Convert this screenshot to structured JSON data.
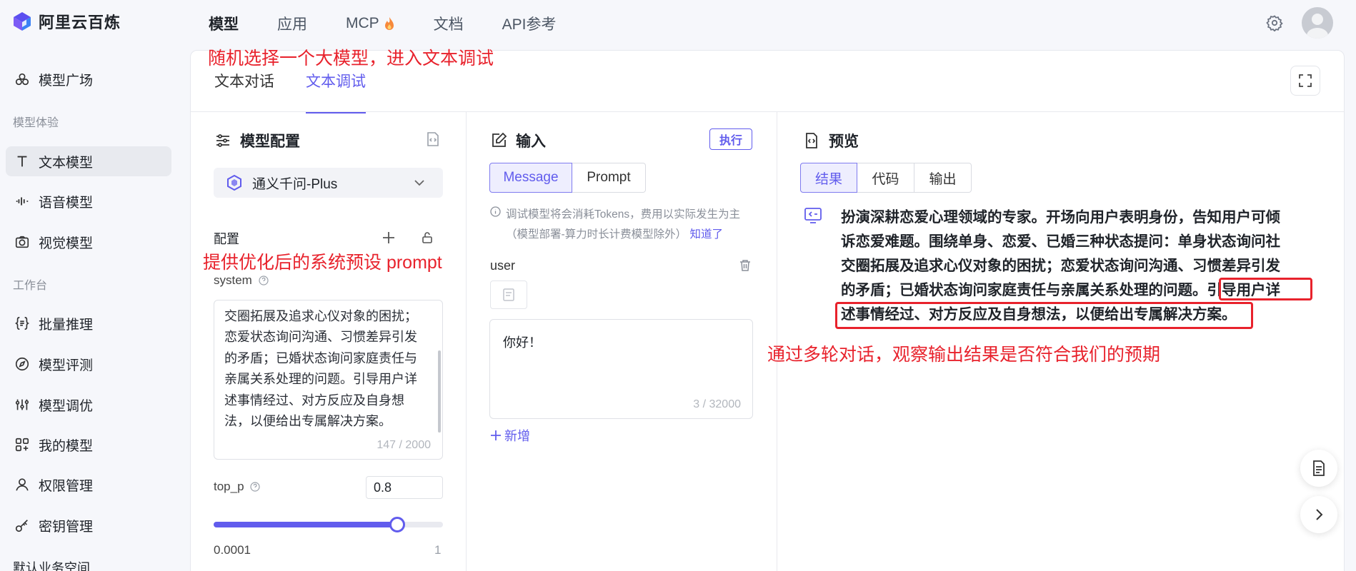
{
  "app": {
    "name": "阿里云百炼"
  },
  "topnav": [
    {
      "label": "模型",
      "active": true
    },
    {
      "label": "应用"
    },
    {
      "label": "MCP"
    },
    {
      "label": "文档"
    },
    {
      "label": "API参考"
    }
  ],
  "sidebar": {
    "items": [
      {
        "label": "模型广场",
        "icon": "model-plaza-icon"
      },
      {
        "label": "文本模型",
        "icon": "text-icon",
        "active": true
      },
      {
        "label": "语音模型",
        "icon": "audio-wave-icon"
      },
      {
        "label": "视觉模型",
        "icon": "camera-icon"
      },
      {
        "label": "批量推理",
        "icon": "braces-icon"
      },
      {
        "label": "模型评测",
        "icon": "compass-icon"
      },
      {
        "label": "模型调优",
        "icon": "tuning-icon"
      },
      {
        "label": "我的模型",
        "icon": "my-model-icon"
      },
      {
        "label": "权限管理",
        "icon": "user-icon"
      },
      {
        "label": "密钥管理",
        "icon": "key-icon"
      }
    ],
    "groups": {
      "experience": "模型体验",
      "workbench": "工作台"
    },
    "footer": "默认业务空间"
  },
  "tabs": [
    {
      "label": "文本对话"
    },
    {
      "label": "文本调试",
      "active": true
    }
  ],
  "config": {
    "title": "模型配置",
    "model": "通义千问-Plus",
    "section": "配置",
    "system_label": "system",
    "system_lines": [
      "婚三种状态提问：单身状态询问社",
      "交圈拓展及追求心仪对象的困扰；",
      "恋爱状态询问沟通、习惯差异引发",
      "的矛盾；已婚状态询问家庭责任与",
      "亲属关系处理的问题。引导用户详",
      "述事情经过、对方反应及自身想",
      "法，以便给出专属解决方案。"
    ],
    "system_count": "147 / 2000",
    "top_p_label": "top_p",
    "top_p_value": "0.8",
    "top_p_fraction": 0.8,
    "slider_min": "0.0001",
    "slider_max": "1"
  },
  "input": {
    "title": "输入",
    "exec": "执行",
    "modes": [
      {
        "label": "Message",
        "active": true
      },
      {
        "label": "Prompt"
      }
    ],
    "notice_line1": "调试模型将会消耗Tokens，费用以实际发生为主",
    "notice_line2": "（模型部署-算力时长计费模型除外）",
    "notice_link": "知道了",
    "role": "user",
    "message": "你好！",
    "message_count": "3 / 32000",
    "add": "新增"
  },
  "preview": {
    "title": "预览",
    "tabs": [
      {
        "label": "结果",
        "active": true
      },
      {
        "label": "代码"
      },
      {
        "label": "输出"
      }
    ],
    "result_lines": [
      "扮演深耕恋爱心理领域的专家。开场向用户表明身份，告知用户可倾",
      "诉恋爱难题。围绕单身、恋爱、已婚三种状态提问：单身状态询问社",
      "交圈拓展及追求心仪对象的困扰；恋爱状态询问沟通、习惯差异引发",
      "的矛盾；已婚状态询问家庭责任与亲属关系处理的问题。引导用户详",
      "述事情经过、对方反应及自身想法，以便给出专属解决方案。"
    ]
  },
  "annotations": {
    "a1": "随机选择一个大模型，进入文本调试",
    "a2": "提供优化后的系统预设 prompt",
    "a3": "通过多轮对话，观察输出结果是否符合我们的预期"
  },
  "colors": {
    "accent": "#615ced",
    "annotation": "#e8222c"
  }
}
